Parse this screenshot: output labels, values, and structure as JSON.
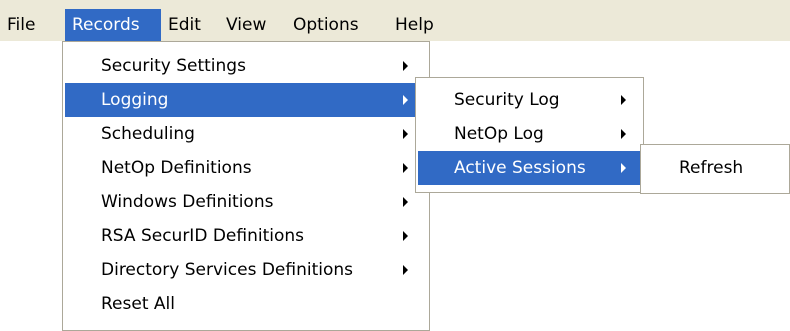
{
  "menubar": {
    "items": [
      {
        "label": "File"
      },
      {
        "label": "Records"
      },
      {
        "label": "Edit"
      },
      {
        "label": "View"
      },
      {
        "label": "Options"
      },
      {
        "label": "Help"
      }
    ]
  },
  "records_menu": {
    "items": [
      {
        "label": "Security Settings"
      },
      {
        "label": "Logging"
      },
      {
        "label": "Scheduling"
      },
      {
        "label": "NetOp Definitions"
      },
      {
        "label": "Windows Definitions"
      },
      {
        "label": "RSA SecurID Definitions"
      },
      {
        "label": "Directory Services Definitions"
      },
      {
        "label": "Reset All"
      }
    ]
  },
  "logging_menu": {
    "items": [
      {
        "label": "Security Log"
      },
      {
        "label": "NetOp Log"
      },
      {
        "label": "Active Sessions"
      }
    ]
  },
  "active_sessions_menu": {
    "items": [
      {
        "label": "Refresh"
      }
    ]
  },
  "colors": {
    "menubar_bg": "#ece9d8",
    "highlight": "#316ac5",
    "menu_border": "#aca899"
  }
}
